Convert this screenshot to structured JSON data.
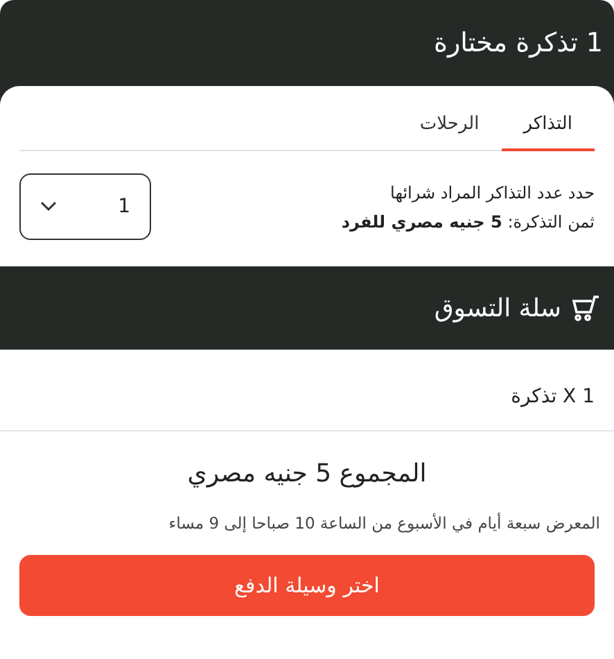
{
  "header": {
    "title": "1 تذكرة مختارة"
  },
  "tabs": [
    {
      "label": "التذاكر",
      "selected": true
    },
    {
      "label": "الرحلات",
      "selected": false
    }
  ],
  "ticket_select": {
    "label": "حدد عدد التذاكر المراد شرائها",
    "price": "ثمن التذكرة: **5 جنيه مصري للفرد**",
    "quantity": "1"
  },
  "cart": {
    "title": "سلة التسوق",
    "items": [
      "X 1 تذكرة"
    ],
    "total": "المجموع 5 جنيه مصري",
    "note": "المعرض سبعة أيام في الأسبوع من الساعة 10 صباحا إلى 9 مساء",
    "button": "اختر وسيلة الدفع"
  }
}
